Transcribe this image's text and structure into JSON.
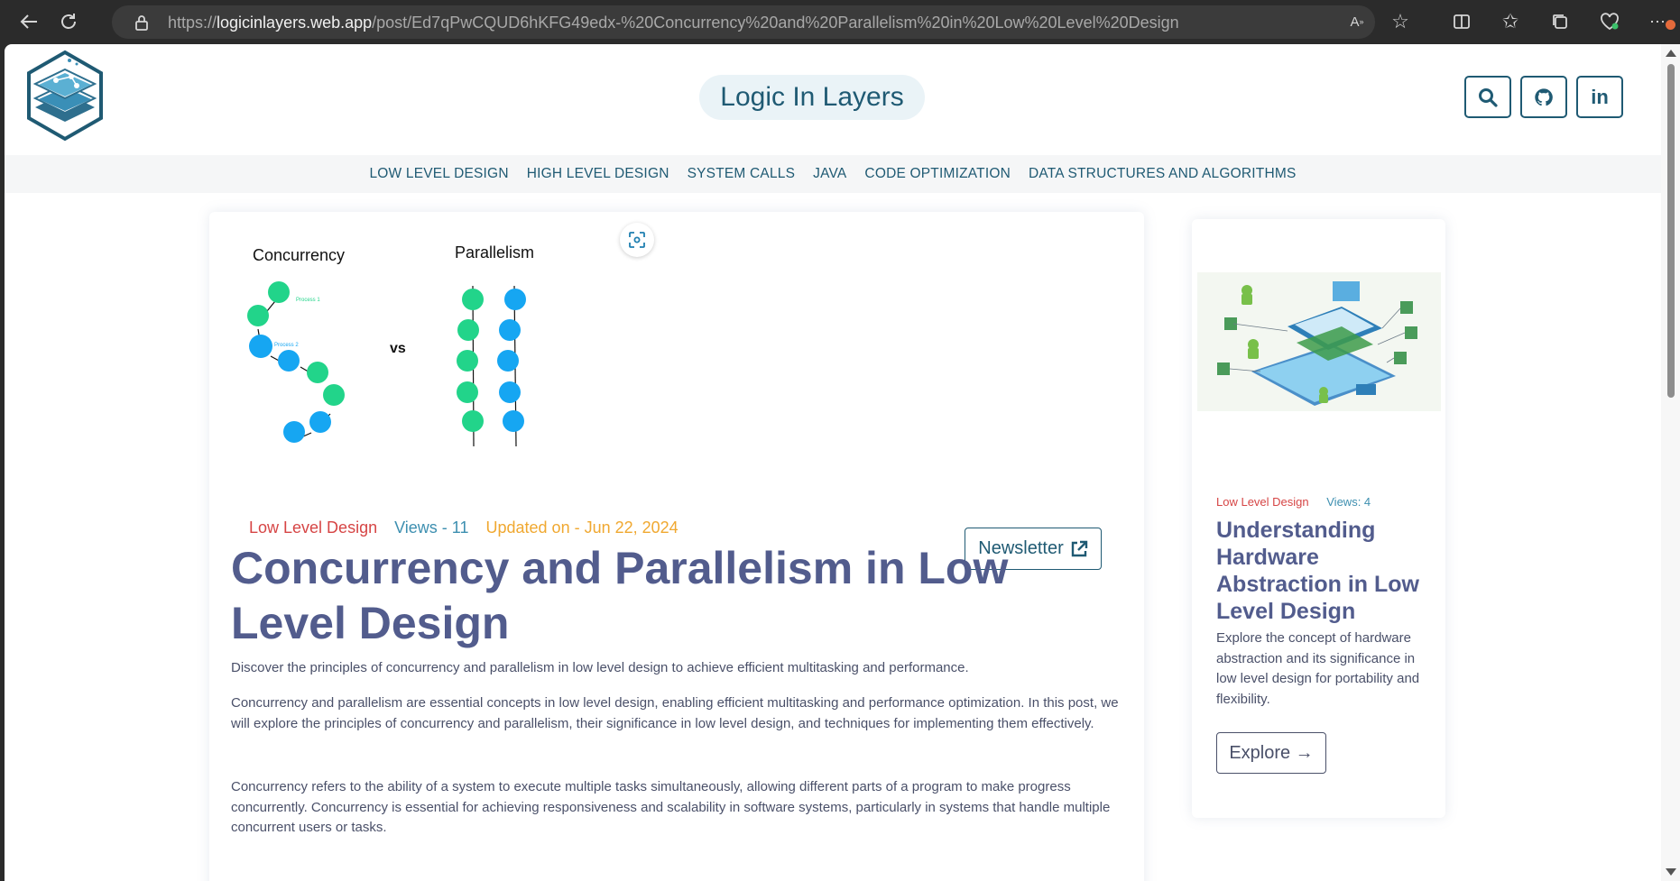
{
  "browser": {
    "url_prefix": "https://",
    "url_domain": "logicinlayers.web.app",
    "url_path": "/post/Ed7qPwCQUD6hKFG49edx-%20Concurrency%20and%20Parallelism%20in%20Low%20Level%20Design"
  },
  "header": {
    "site_title": "Logic In Layers"
  },
  "nav": {
    "items": [
      "LOW LEVEL DESIGN",
      "HIGH LEVEL DESIGN",
      "SYSTEM CALLS",
      "JAVA",
      "CODE OPTIMIZATION",
      "DATA STRUCTURES AND ALGORITHMS"
    ]
  },
  "hero": {
    "left_label": "Concurrency",
    "right_label": "Parallelism",
    "vs_label": "vs",
    "process1_label": "Process 1",
    "process2_label": "Process 2"
  },
  "post": {
    "category": "Low Level Design",
    "views": "Views - 11",
    "updated": "Updated on - Jun 22, 2024",
    "newsletter_label": "Newsletter",
    "title": "Concurrency and Parallelism in Low Level Design",
    "lead": "Discover the principles of concurrency and parallelism in low level design to achieve efficient multitasking and performance.",
    "p1": "Concurrency and parallelism are essential concepts in low level design, enabling efficient multitasking and performance optimization. In this post, we will explore the principles of concurrency and parallelism, their significance in low level design, and techniques for implementing them effectively.",
    "p2": "Concurrency refers to the ability of a system to execute multiple tasks simultaneously, allowing different parts of a program to make progress concurrently. Concurrency is essential for achieving responsiveness and scalability in software systems, particularly in systems that handle multiple concurrent users or tasks."
  },
  "sidebar": {
    "category": "Low Level Design",
    "views": "Views: 4",
    "title": "Understanding Hardware Abstraction in Low Level Design",
    "desc": "Explore the concept of hardware abstraction and its significance in low level design for portability and flexibility.",
    "explore_label": "Explore →"
  },
  "colors": {
    "accent": "#1f5a73",
    "title": "#525c8d",
    "category": "#d64545",
    "views": "#3d8fb0",
    "updated": "#f0a830",
    "green_node": "#22d48a",
    "blue_node": "#16a6f2"
  }
}
